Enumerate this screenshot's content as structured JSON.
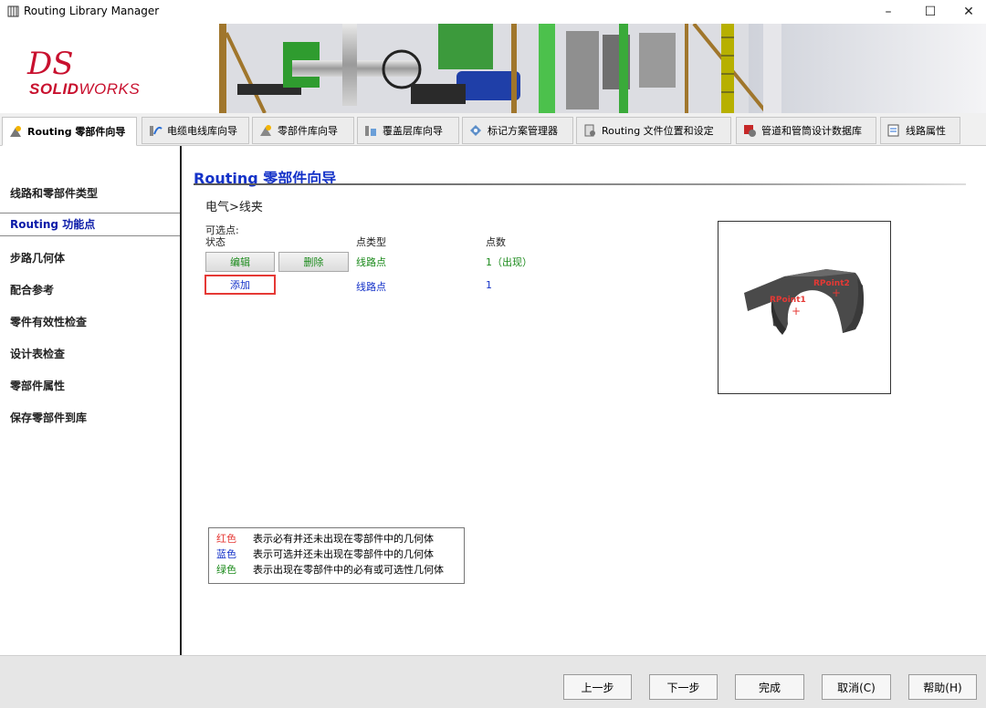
{
  "window": {
    "title": "Routing Library Manager",
    "controls": [
      "–",
      "☐",
      "✕"
    ]
  },
  "branding": {
    "ds": "DS",
    "bold": "SOLID",
    "rest": "WORKS"
  },
  "tabs": [
    {
      "label": "Routing 零部件向导",
      "icon": "routing-wizard-icon"
    },
    {
      "label": "电缆电线库向导",
      "icon": "cable-library-icon"
    },
    {
      "label": "零部件库向导",
      "icon": "component-library-icon"
    },
    {
      "label": "覆盖层库向导",
      "icon": "covering-library-icon"
    },
    {
      "label": "标记方案管理器",
      "icon": "tag-scheme-icon"
    },
    {
      "label": "Routing 文件位置和设定",
      "icon": "file-locations-icon"
    },
    {
      "label": "管道和管筒设计数据库",
      "icon": "piping-database-icon"
    },
    {
      "label": "线路属性",
      "icon": "route-properties-icon"
    }
  ],
  "sidebar": {
    "items": [
      "线路和零部件类型",
      "Routing 功能点",
      "步路几何体",
      "配合参考",
      "零件有效性检查",
      "设计表检查",
      "零部件属性",
      "保存零部件到库"
    ],
    "active_index": 1
  },
  "main": {
    "title": "Routing 零部件向导",
    "path": "电气>线夹",
    "optional_label": "可选点:",
    "columns": {
      "status": "状态",
      "point_type": "点类型",
      "count": "点数"
    },
    "rows": [
      {
        "edit": "编辑",
        "delete": "删除",
        "point_type": "线路点",
        "count": "1（出现）"
      },
      {
        "add": "添加",
        "point_type": "线路点",
        "count": "1"
      }
    ],
    "preview": {
      "label1": "RPoint1",
      "label2": "RPoint2"
    },
    "legend": [
      {
        "key": "红色",
        "text": "表示必有并还未出现在零部件中的几何体",
        "color": "#e53935"
      },
      {
        "key": "蓝色",
        "text": "表示可选并还未出现在零部件中的几何体",
        "color": "#1432c8"
      },
      {
        "key": "绿色",
        "text": "表示出现在零部件中的必有或可选性几何体",
        "color": "#1b8a1b"
      }
    ]
  },
  "footer": {
    "prev": "上一步",
    "next": "下一步",
    "finish": "完成",
    "cancel": "取消(C)",
    "help": "帮助(H)"
  }
}
